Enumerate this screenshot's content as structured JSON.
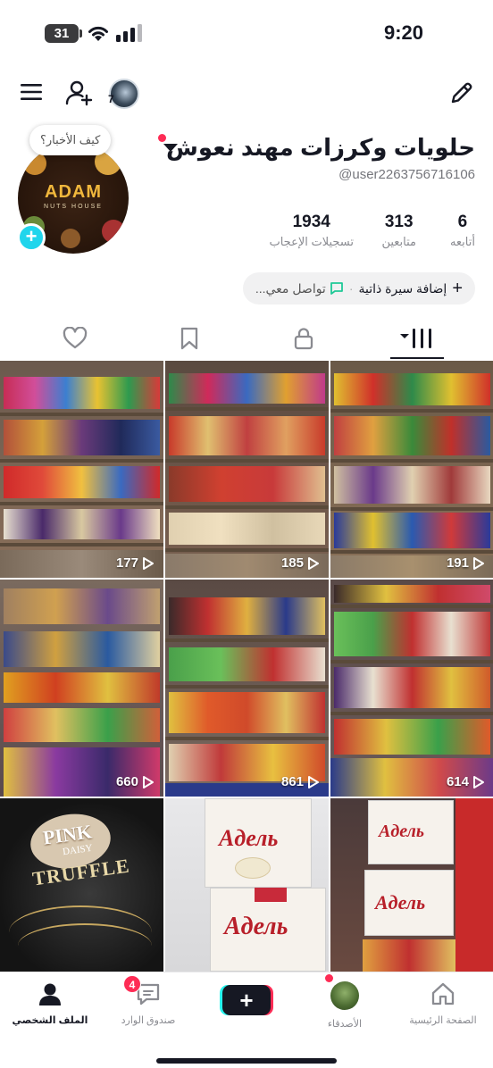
{
  "status_bar": {
    "time": "9:20",
    "battery": "31"
  },
  "profile": {
    "display_name": "حلويات وكرزات مهند نعوش",
    "username": "@user2263756716106",
    "news_bubble": "كيف الأخبار؟",
    "avatar_count": "7",
    "profile_pic_text": "ADAM",
    "profile_pic_subtext": "NUTS HOUSE"
  },
  "stats": {
    "following": {
      "value": "6",
      "label": "أتابعه"
    },
    "followers": {
      "value": "313",
      "label": "متابعين"
    },
    "likes": {
      "value": "1934",
      "label": "تسجيلات الإعجاب"
    }
  },
  "bio": {
    "add_bio": "إضافة سيرة ذاتية",
    "separator": "·",
    "contact": "تواصل معي..."
  },
  "videos": [
    {
      "views": "177"
    },
    {
      "views": "185"
    },
    {
      "views": "191"
    },
    {
      "views": "660"
    },
    {
      "views": "861"
    },
    {
      "views": "614"
    },
    {
      "views": ""
    },
    {
      "views": ""
    },
    {
      "views": ""
    }
  ],
  "tile_texts": {
    "pink_brand": "PINK",
    "pink_sub": "DAISY",
    "truffle": "TRUFFLE",
    "adel": "Aдель"
  },
  "bottom_nav": {
    "home": "الصفحة الرئيسية",
    "friends": "الأصدقاء",
    "inbox": "صندوق الوارد",
    "inbox_badge": "4",
    "profile": "الملف الشخصي"
  },
  "colors": {
    "accent_red": "#fe2c55",
    "accent_cyan": "#20d5ec",
    "text_primary": "#161823"
  }
}
